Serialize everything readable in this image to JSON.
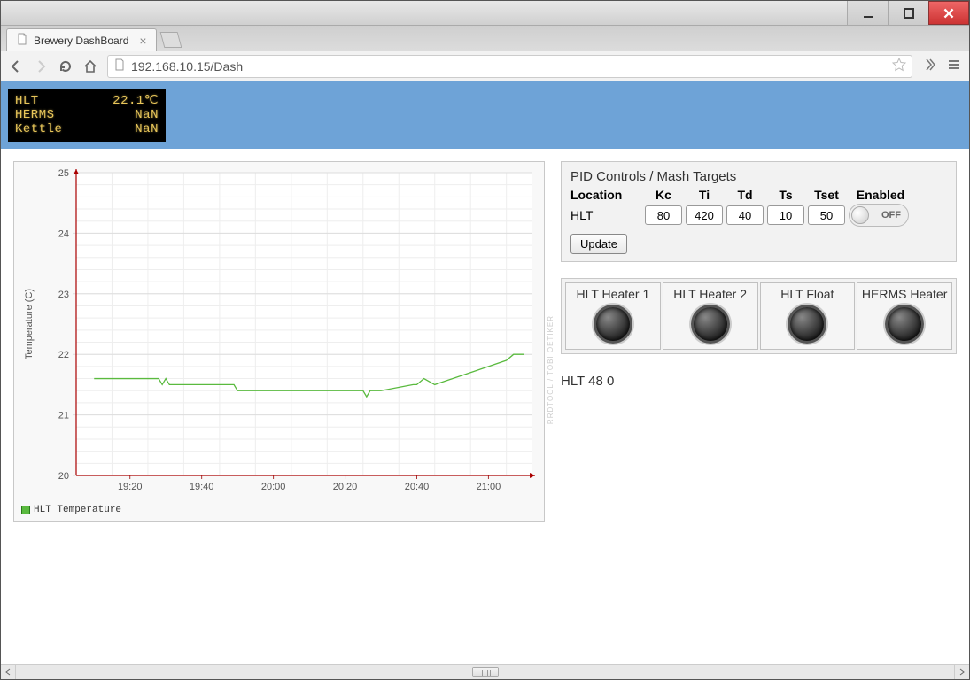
{
  "window": {
    "tab_title": "Brewery DashBoard",
    "url": "192.168.10.15/Dash"
  },
  "lcd": {
    "rows": [
      {
        "label": "HLT",
        "value": "22.1℃"
      },
      {
        "label": "HERMS",
        "value": "NaN"
      },
      {
        "label": "Kettle",
        "value": "NaN"
      }
    ]
  },
  "pid": {
    "title": "PID Controls / Mash Targets",
    "headers": {
      "location": "Location",
      "kc": "Kc",
      "ti": "Ti",
      "td": "Td",
      "ts": "Ts",
      "tset": "Tset",
      "enabled": "Enabled"
    },
    "row": {
      "location": "HLT",
      "kc": "80",
      "ti": "420",
      "td": "40",
      "ts": "10",
      "tset": "50",
      "enabled_label": "OFF"
    },
    "update_label": "Update"
  },
  "heaters": [
    {
      "label": "HLT Heater 1"
    },
    {
      "label": "HLT Heater 2"
    },
    {
      "label": "HLT Float"
    },
    {
      "label": "HERMS Heater"
    }
  ],
  "status_line": "HLT 48 0",
  "chart_data": {
    "type": "line",
    "title": "",
    "xlabel": "",
    "ylabel": "Temperature (C)",
    "ylim": [
      20,
      25
    ],
    "yticks": [
      20,
      21,
      22,
      23,
      24,
      25
    ],
    "xticks": [
      "19:20",
      "19:40",
      "20:00",
      "20:20",
      "20:40",
      "21:00"
    ],
    "series": [
      {
        "name": "HLT Temperature",
        "color": "#5aba3f",
        "x": [
          "19:10",
          "19:20",
          "19:28",
          "19:29",
          "19:30",
          "19:31",
          "19:40",
          "19:49",
          "19:50",
          "20:00",
          "20:20",
          "20:25",
          "20:26",
          "20:27",
          "20:30",
          "20:39",
          "20:40",
          "20:42",
          "20:45",
          "20:55",
          "21:00",
          "21:05",
          "21:07",
          "21:10"
        ],
        "values": [
          21.6,
          21.6,
          21.6,
          21.5,
          21.6,
          21.5,
          21.5,
          21.5,
          21.4,
          21.4,
          21.4,
          21.4,
          21.3,
          21.4,
          21.4,
          21.5,
          21.5,
          21.6,
          21.5,
          21.7,
          21.8,
          21.9,
          22.0,
          22.0
        ]
      }
    ],
    "legend": "HLT Temperature",
    "credit": "RRDTOOL / TOBI OETIKER"
  }
}
